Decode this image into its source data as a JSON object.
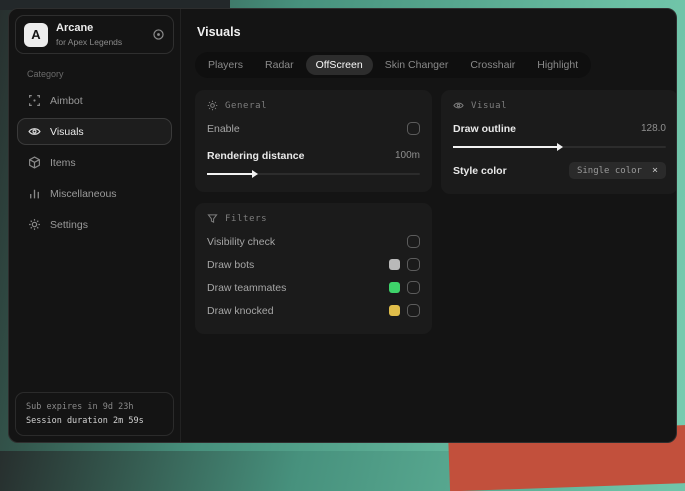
{
  "app": {
    "name": "Arcane",
    "subtitle": "for Apex Legends",
    "logo_letter": "A"
  },
  "sidebar": {
    "category_label": "Category",
    "items": [
      {
        "label": "Aimbot"
      },
      {
        "label": "Visuals"
      },
      {
        "label": "Items"
      },
      {
        "label": "Miscellaneous"
      },
      {
        "label": "Settings"
      }
    ],
    "footer": {
      "line1": "Sub expires in 9d 23h",
      "line2": "Session duration 2m 59s"
    }
  },
  "main": {
    "title": "Visuals",
    "tabs": [
      {
        "label": "Players"
      },
      {
        "label": "Radar"
      },
      {
        "label": "OffScreen"
      },
      {
        "label": "Skin Changer"
      },
      {
        "label": "Crosshair"
      },
      {
        "label": "Highlight"
      }
    ],
    "active_tab": "OffScreen",
    "general": {
      "title": "General",
      "enable_label": "Enable",
      "rendering_distance_label": "Rendering distance",
      "rendering_distance_value": "100m"
    },
    "filters": {
      "title": "Filters",
      "rows": [
        {
          "label": "Visibility check"
        },
        {
          "label": "Draw bots",
          "swatch": "#b9b9b9"
        },
        {
          "label": "Draw teammates",
          "swatch": "#3ed26a"
        },
        {
          "label": "Draw knocked",
          "swatch": "#e0bd4a"
        }
      ]
    },
    "visual": {
      "title": "Visual",
      "draw_outline_label": "Draw outline",
      "draw_outline_value": "128.0",
      "style_color_label": "Style color",
      "style_color_value": "Single color",
      "clear_icon": "×"
    }
  },
  "colors": {
    "swatch_gray": "#b9b9b9",
    "swatch_green": "#3ed26a",
    "swatch_yellow": "#e0bd4a",
    "background_teal": "#57a78f",
    "background_red": "#c2503c"
  }
}
